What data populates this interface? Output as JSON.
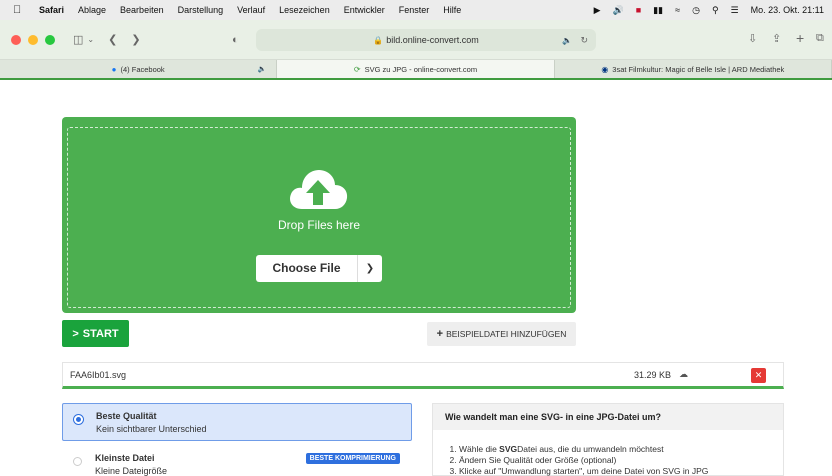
{
  "menubar": {
    "app": "Safari",
    "items": [
      "Ablage",
      "Bearbeiten",
      "Darstellung",
      "Verlauf",
      "Lesezeichen",
      "Entwickler",
      "Fenster",
      "Hilfe"
    ],
    "datetime": "Mo. 23. Okt. 21:11"
  },
  "browser": {
    "url": "bild.online-convert.com",
    "tabs": [
      {
        "label": "(4) Facebook"
      },
      {
        "label": "SVG zu JPG - online-convert.com"
      },
      {
        "label": "3sat Filmkultur: Magic of Belle Isle | ARD Mediathek"
      }
    ]
  },
  "upload": {
    "drop_text": "Drop Files here",
    "choose_label": "Choose File"
  },
  "actions": {
    "start_label": "START",
    "sample_label": "BEISPIELDATEI HINZUFÜGEN"
  },
  "file": {
    "name": "FAA6Ib01.svg",
    "size": "31.29 KB"
  },
  "options": [
    {
      "title": "Beste Qualität",
      "subtitle": "Kein sichtbarer Unterschied",
      "badge": ""
    },
    {
      "title": "Kleinste Datei",
      "subtitle": "Kleine Dateigröße",
      "badge": "BESTE KOMPRIMIERUNG"
    }
  ],
  "info": {
    "heading": "Wie wandelt man eine SVG- in eine JPG-Datei um?",
    "step1_pre": "Wähle die ",
    "step1_bold": "SVG",
    "step1_post": "Datei aus, die du umwandeln möchtest",
    "step2": "Ändern Sie Qualität oder Größe (optional)",
    "step3": "Klicke auf \"Umwandlung starten\", um deine Datei von SVG in JPG"
  },
  "colors": {
    "accent_green": "#4caf50",
    "start_green": "#1aa33c",
    "selected_blue": "#2e6fde",
    "delete_red": "#e53935"
  }
}
